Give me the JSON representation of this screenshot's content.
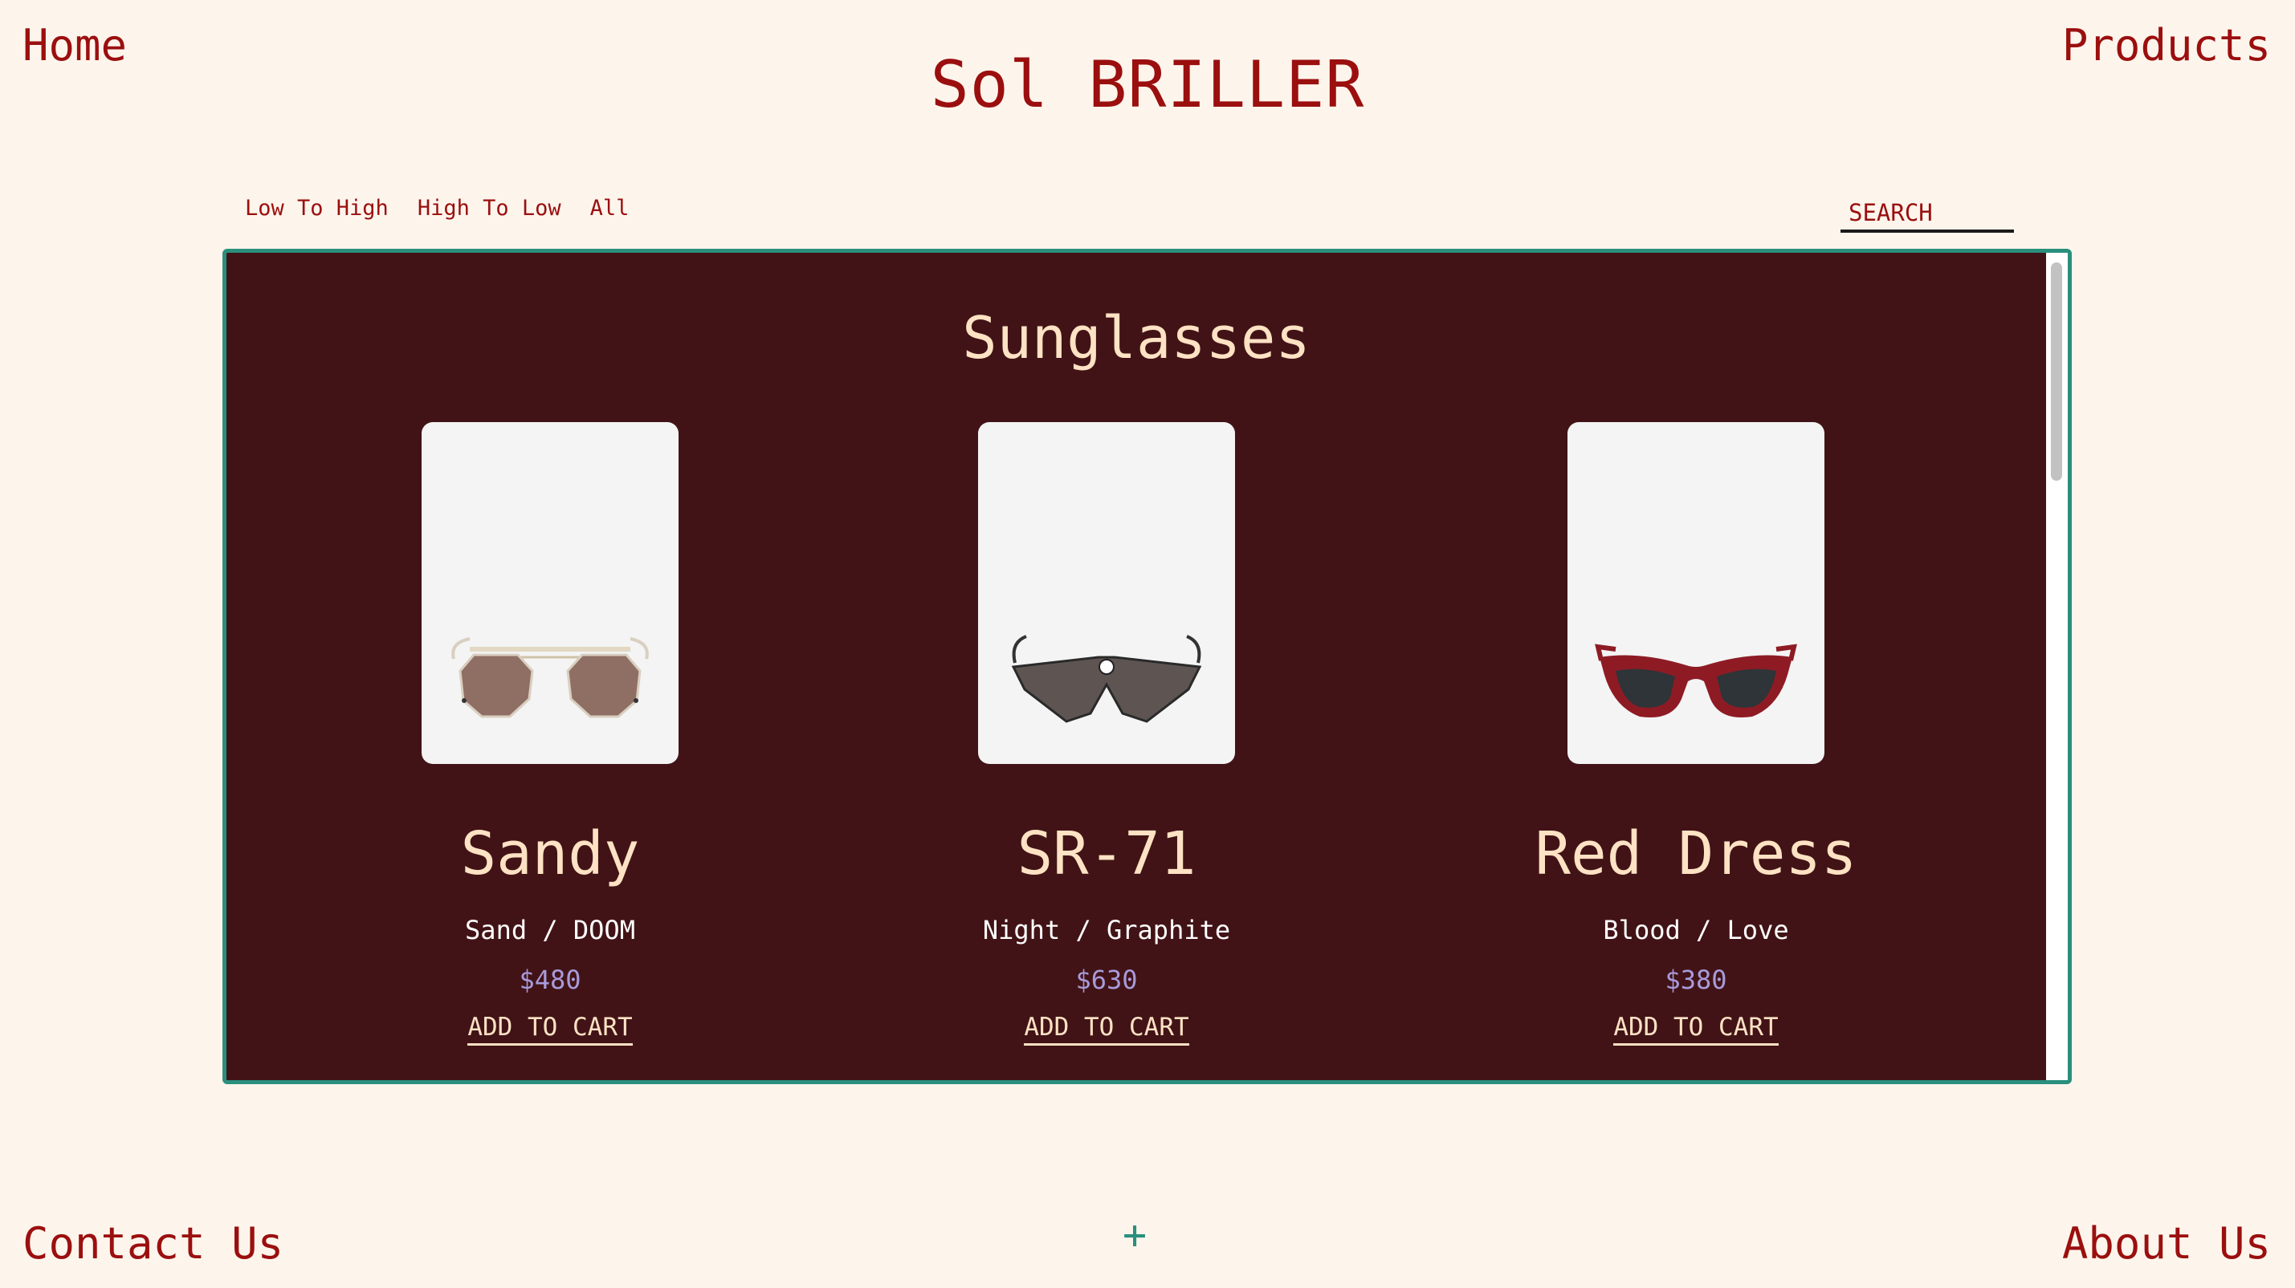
{
  "nav": {
    "home": "Home",
    "products": "Products",
    "contact": "Contact Us",
    "about": "About Us"
  },
  "brand": "Sol BRILLER",
  "sort": {
    "low_to_high": "Low To High",
    "high_to_low": "High To Low",
    "all": "All"
  },
  "search": {
    "placeholder": "SEARCH"
  },
  "section": {
    "title": "Sunglasses"
  },
  "products": [
    {
      "name": "Sandy",
      "variant": "Sand / DOOM",
      "price": "$480",
      "cta": "ADD TO CART",
      "image_icon": "aviator-sunglasses-icon"
    },
    {
      "name": "SR-71",
      "variant": "Night / Graphite",
      "price": "$630",
      "cta": "ADD TO CART",
      "image_icon": "shield-sunglasses-icon"
    },
    {
      "name": "Red Dress",
      "variant": "Blood / Love",
      "price": "$380",
      "cta": "ADD TO CART",
      "image_icon": "cat-eye-sunglasses-icon"
    }
  ],
  "footer": {
    "plus": "+"
  },
  "colors": {
    "background": "#fdf5ec",
    "brand_red": "#9b0f0f",
    "panel": "#421316",
    "panel_border": "#2a8f7d",
    "cream": "#fde2c4",
    "price": "#a79bdb"
  }
}
